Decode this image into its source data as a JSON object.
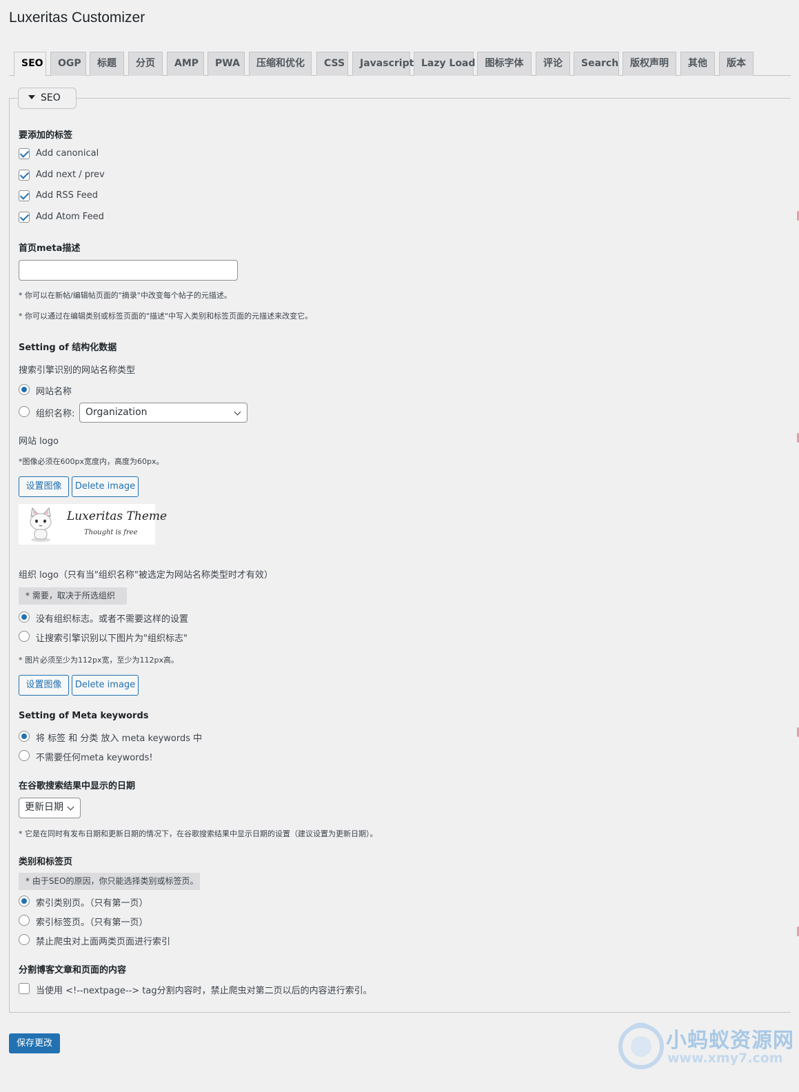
{
  "page_title": "Luxeritas Customizer",
  "tabs": [
    "SEO",
    "OGP",
    "标题",
    "分页",
    "AMP",
    "PWA",
    "压缩和优化",
    "CSS",
    "Javascript",
    "Lazy Load",
    "图标字体",
    "评论",
    "Search",
    "版权声明",
    "其他",
    "版本"
  ],
  "active_tab": "SEO",
  "section_legend": "SEO",
  "tags_section": {
    "heading": "要添加的标签",
    "options": [
      {
        "label": "Add canonical",
        "checked": true
      },
      {
        "label": "Add next / prev",
        "checked": true
      },
      {
        "label": "Add RSS Feed",
        "checked": true
      },
      {
        "label": "Add Atom Feed",
        "checked": true
      }
    ]
  },
  "meta_description": {
    "heading": "首页meta描述",
    "value": "",
    "note1": "* 你可以在新帖/编辑帖页面的\"摘录\"中改变每个帖子的元描述。",
    "note2": "* 你可以通过在编辑类别或标签页面的\"描述\"中写入类别和标签页面的元描述来改变它。"
  },
  "structured_data": {
    "heading": "Setting of 结构化数据",
    "sub_label": "搜索引擎识别的网站名称类型",
    "radio_site_name": "网站名称",
    "radio_org_name": "组织名称:",
    "org_select_value": "Organization",
    "site_logo_label": "网站 logo",
    "site_logo_note": "*图像必须在600px宽度内，高度为60px。",
    "set_image_button": "设置图像",
    "delete_image_button": "Delete image",
    "logo_preview_text": "Luxeritas Theme",
    "logo_preview_sub": "Thought is free",
    "org_logo_label": "组织 logo（只有当\"组织名称\"被选定为网站名称类型时才有效）",
    "org_logo_requirement": "* 需要，取决于所选组织",
    "org_logo_option_none": "没有组织标志。或者不需要这样的设置",
    "org_logo_option_use": "让搜索引擎识别以下图片为\"组织标志\"",
    "org_logo_note": "* 图片必须至少为112px宽，至少为112px高。"
  },
  "meta_keywords": {
    "heading": "Setting of Meta keywords",
    "option_put": "将 标签 和 分类 放入 meta keywords 中",
    "option_none": "不需要任何meta keywords!"
  },
  "google_date": {
    "heading": "在谷歌搜索结果中显示的日期",
    "select_value": "更新日期",
    "note": "* 它是在同时有发布日期和更新日期的情况下，在谷歌搜索结果中显示日期的设置（建议设置为更新日期）。"
  },
  "category_tag_pages": {
    "heading": "类别和标签页",
    "notice": "* 由于SEO的原因，你只能选择类别或标签页。",
    "option_category": "索引类别页。（只有第一页）",
    "option_tag": "索引标签页。（只有第一页）",
    "option_none": "禁止爬虫对上面两类页面进行索引"
  },
  "split_content": {
    "heading": "分割博客文章和页面的内容",
    "option": "当使用 <!--nextpage--> tag分割内容时，禁止爬虫对第二页以后的内容进行索引。",
    "checked": false
  },
  "save_button": "保存更改",
  "watermark": {
    "line1": "小蚂蚁资源网",
    "line2": "www.xmy7.com"
  },
  "colors": {
    "accent": "#2271b1",
    "background": "#f0f0f1"
  }
}
